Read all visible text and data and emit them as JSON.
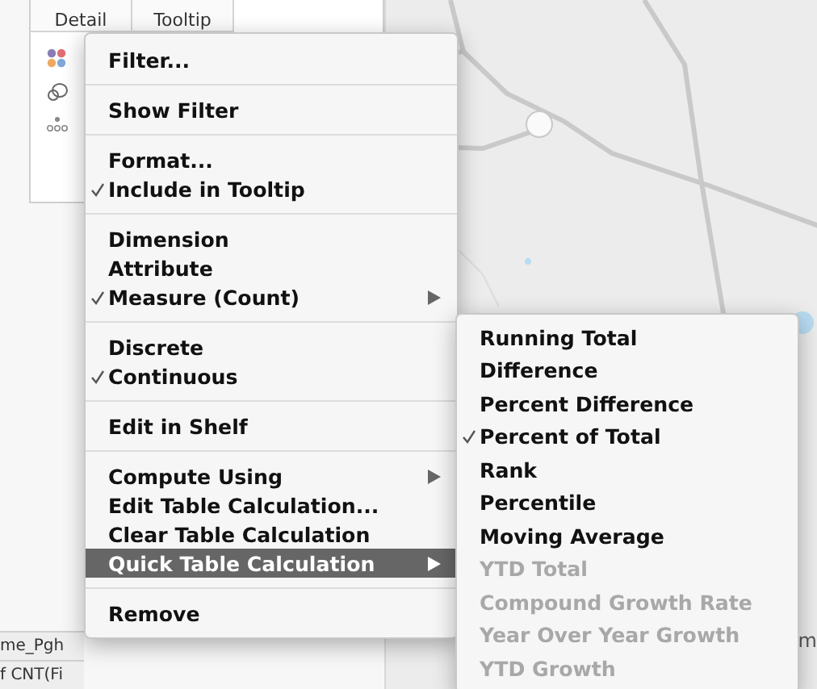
{
  "marks_card": {
    "buttons": [
      {
        "label": "Detail"
      },
      {
        "label": "Tooltip"
      }
    ]
  },
  "shelf_pills": [
    {
      "label": "me_Pgh"
    },
    {
      "label": "f CNT(Fi"
    }
  ],
  "behind_text": "m",
  "context_menu": {
    "groups": [
      [
        {
          "label": "Filter...",
          "checked": false,
          "submenu": false,
          "selected": false
        }
      ],
      [
        {
          "label": "Show Filter",
          "checked": false,
          "submenu": false,
          "selected": false
        }
      ],
      [
        {
          "label": "Format...",
          "checked": false,
          "submenu": false,
          "selected": false
        },
        {
          "label": "Include in Tooltip",
          "checked": true,
          "submenu": false,
          "selected": false
        }
      ],
      [
        {
          "label": "Dimension",
          "checked": false,
          "submenu": false,
          "selected": false
        },
        {
          "label": "Attribute",
          "checked": false,
          "submenu": false,
          "selected": false
        },
        {
          "label": "Measure (Count)",
          "checked": true,
          "submenu": true,
          "selected": false
        }
      ],
      [
        {
          "label": "Discrete",
          "checked": false,
          "submenu": false,
          "selected": false
        },
        {
          "label": "Continuous",
          "checked": true,
          "submenu": false,
          "selected": false
        }
      ],
      [
        {
          "label": "Edit in Shelf",
          "checked": false,
          "submenu": false,
          "selected": false
        }
      ],
      [
        {
          "label": "Compute Using",
          "checked": false,
          "submenu": true,
          "selected": false
        },
        {
          "label": "Edit Table Calculation...",
          "checked": false,
          "submenu": false,
          "selected": false
        },
        {
          "label": "Clear Table Calculation",
          "checked": false,
          "submenu": false,
          "selected": false
        },
        {
          "label": "Quick Table Calculation",
          "checked": false,
          "submenu": true,
          "selected": true
        }
      ],
      [
        {
          "label": "Remove",
          "checked": false,
          "submenu": false,
          "selected": false
        }
      ]
    ]
  },
  "submenu": {
    "items": [
      {
        "label": "Running Total",
        "checked": false,
        "disabled": false
      },
      {
        "label": "Difference",
        "checked": false,
        "disabled": false
      },
      {
        "label": "Percent Difference",
        "checked": false,
        "disabled": false
      },
      {
        "label": "Percent of Total",
        "checked": true,
        "disabled": false
      },
      {
        "label": "Rank",
        "checked": false,
        "disabled": false
      },
      {
        "label": "Percentile",
        "checked": false,
        "disabled": false
      },
      {
        "label": "Moving Average",
        "checked": false,
        "disabled": false
      },
      {
        "label": "YTD Total",
        "checked": false,
        "disabled": true
      },
      {
        "label": "Compound Growth Rate",
        "checked": false,
        "disabled": true
      },
      {
        "label": "Year Over Year Growth",
        "checked": false,
        "disabled": true
      },
      {
        "label": "YTD Growth",
        "checked": false,
        "disabled": true
      }
    ]
  }
}
